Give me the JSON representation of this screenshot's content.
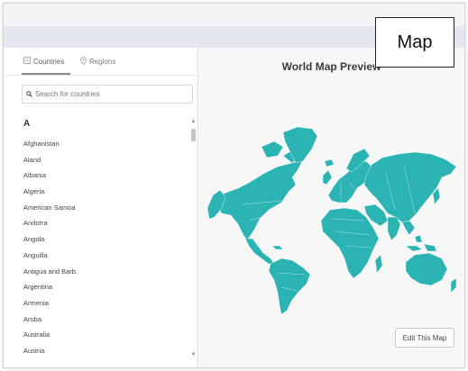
{
  "tabs": [
    {
      "label": "Countries",
      "icon": "list-icon",
      "active": true
    },
    {
      "label": "Regions",
      "icon": "pin-icon",
      "active": false
    }
  ],
  "search": {
    "placeholder": "Search for countries"
  },
  "list": {
    "section_letter": "A",
    "items": [
      "Afghanistan",
      "Aland",
      "Albania",
      "Algeria",
      "American Samoa",
      "Andorra",
      "Angola",
      "Anguilla",
      "Antigua and Barb.",
      "Argentina",
      "Armenia",
      "Aruba",
      "Australia",
      "Austria"
    ]
  },
  "main": {
    "title": "World Map Preview",
    "edit_button": "Edit This Map",
    "map_color": "#2cb3b3"
  },
  "callout": {
    "label": "Map"
  }
}
